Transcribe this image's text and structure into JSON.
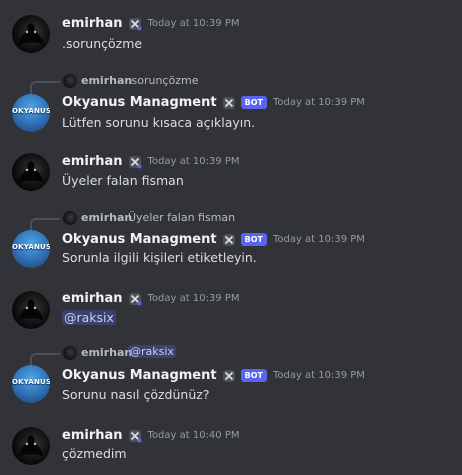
{
  "users": {
    "emirhan": {
      "name": "emirhan"
    },
    "bot": {
      "name": "Okyanus Managment",
      "badge": "BOT",
      "avatar_text": "OKYANUS"
    }
  },
  "messages": [
    {
      "author": "emirhan",
      "timestamp": "Today at 10:39 PM",
      "text": ".sorunçözme"
    },
    {
      "author": "Okyanus Managment",
      "timestamp": "Today at 10:39 PM",
      "text": "Lütfen sorunu kısaca açıklayın.",
      "reply": {
        "author": "emirhan",
        "text": ".sorunçözme"
      }
    },
    {
      "author": "emirhan",
      "timestamp": "Today at 10:39 PM",
      "text": "Üyeler falan fisman"
    },
    {
      "author": "Okyanus Managment",
      "timestamp": "Today at 10:39 PM",
      "text": "Sorunla ilgili kişileri etiketleyin.",
      "reply": {
        "author": "emirhan",
        "text": "Üyeler falan fisman"
      }
    },
    {
      "author": "emirhan",
      "timestamp": "Today at 10:39 PM",
      "text": "@raksix"
    },
    {
      "author": "Okyanus Managment",
      "timestamp": "Today at 10:39 PM",
      "text": "Sorunu nasıl çözdünüz?",
      "reply": {
        "author": "emirhan",
        "text": "@raksix"
      }
    },
    {
      "author": "emirhan",
      "timestamp": "Today at 10:40 PM",
      "text": "çözmedim"
    }
  ],
  "colors": {
    "background": "#313338",
    "mention_bg": "#4b5196",
    "bot_badge": "#5865f2"
  },
  "icons": {
    "role_icon": "crossed-hammers-icon"
  }
}
